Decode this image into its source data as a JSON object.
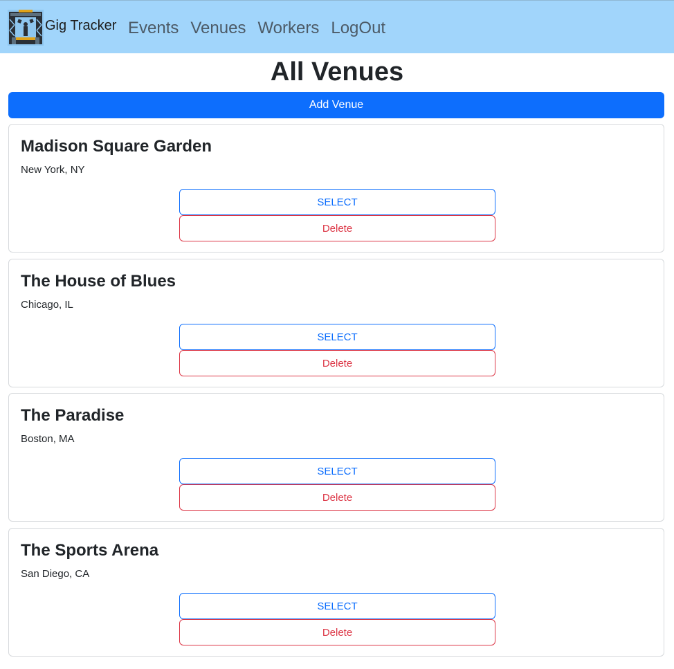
{
  "navbar": {
    "brand": "Gig Tracker",
    "logo_icon": "stage-truss-logo-icon",
    "links": [
      {
        "label": "Events"
      },
      {
        "label": "Venues"
      },
      {
        "label": "Workers"
      },
      {
        "label": "LogOut"
      }
    ],
    "background": "#a1d5fb"
  },
  "page": {
    "title": "All Venues",
    "add_button_label": "Add Venue"
  },
  "venues": [
    {
      "name": "Madison Square Garden",
      "location": "New York, NY",
      "select_label": "SELECT",
      "delete_label": "Delete"
    },
    {
      "name": "The House of Blues",
      "location": "Chicago, IL",
      "select_label": "SELECT",
      "delete_label": "Delete"
    },
    {
      "name": "The Paradise",
      "location": "Boston, MA",
      "select_label": "SELECT",
      "delete_label": "Delete"
    },
    {
      "name": "The Sports Arena",
      "location": "San Diego, CA",
      "select_label": "SELECT",
      "delete_label": "Delete"
    }
  ],
  "colors": {
    "primary": "#0d6efd",
    "danger": "#dc3545"
  }
}
